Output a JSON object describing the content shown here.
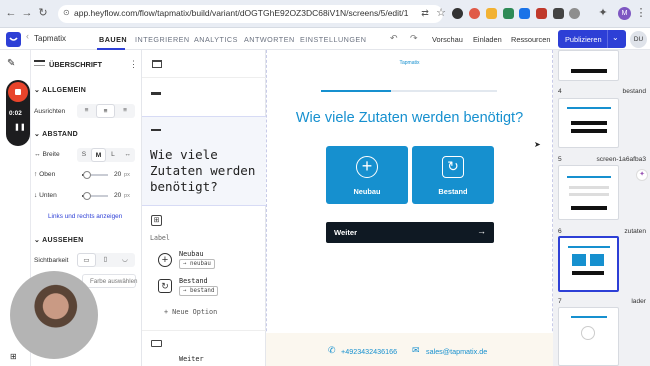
{
  "browser": {
    "url": "app.heyflow.com/flow/tapmatix/build/variant/dOGTGhE92OZ3DC68iV1N/screens/5/edit/1",
    "profile_initial": "M"
  },
  "app": {
    "project_name": "Tapmatix",
    "nav_tabs": [
      "BAUEN",
      "INTEGRIEREN",
      "ANALYTICS",
      "ANTWORTEN",
      "EINSTELLUNGEN"
    ],
    "active_tab": "BAUEN",
    "preview_label": "Vorschau",
    "invite_label": "Einladen",
    "resources_label": "Ressourcen",
    "publish_label": "Publizieren",
    "avatar_initials": "DU"
  },
  "recorder": {
    "time": "0:02"
  },
  "left_panel": {
    "title": "ÜBERSCHRIFT",
    "general_section": "ALLGEMEIN",
    "align_label": "Ausrichten",
    "spacing_section": "ABSTAND",
    "width_label": "Breite",
    "width_options": [
      "S",
      "M",
      "L"
    ],
    "width_selected": "M",
    "top_label": "Oben",
    "top_value": "20",
    "top_unit": "px",
    "top_level": 0.2,
    "bottom_label": "Unten",
    "bottom_value": "20",
    "bottom_unit": "px",
    "bottom_level": 0.2,
    "show_lr_link": "Links und rechts anzeigen",
    "appearance_section": "AUSSEHEN",
    "visibility_label": "Sichtbarkeit",
    "color_label": "Farbe auswählen"
  },
  "tree": {
    "heading_preview": "Wie viele Zutaten werden benötigt?",
    "label_text": "Label",
    "option1_name": "Neubau",
    "option1_tag": "→ neubau",
    "option2_name": "Bestand",
    "option2_tag": "→ bestand",
    "add_option": "+ Neue Option",
    "next_label": "Weiter"
  },
  "canvas": {
    "logo_text": "Tapmatix",
    "progress": 0.4,
    "heading": "Wie viele Zutaten werden benötigt?",
    "option1": "Neubau",
    "option2": "Bestand",
    "next_button": "Weiter",
    "phone": "+4923432436166",
    "email": "sales@tapmatix.de",
    "accent_color": "#1690cf",
    "button_color": "#0f1923"
  },
  "screens": [
    {
      "num": "4",
      "name": "bestand"
    },
    {
      "num": "5",
      "name": "screen-1a6afba3"
    },
    {
      "num": "6",
      "name": "zutaten"
    },
    {
      "num": "7",
      "name": "lader"
    }
  ]
}
